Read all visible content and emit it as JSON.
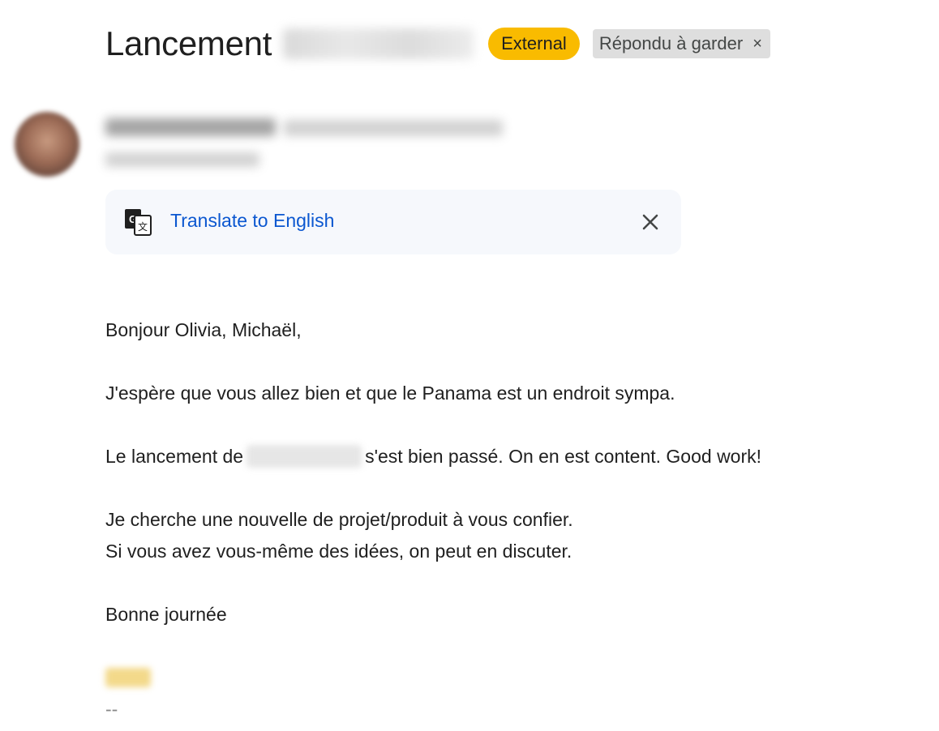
{
  "subject": {
    "title": "Lancement",
    "badges": {
      "external": "External",
      "label": "Répondu à garder",
      "label_remove_glyph": "×"
    }
  },
  "sender": {
    "avatar_icon": "avatar"
  },
  "translate": {
    "icon": "translate-icon",
    "link_text": "Translate to English",
    "close_icon": "close-icon",
    "link_color": "#0b57d0"
  },
  "message": {
    "greeting": "Bonjour Olivia, Michaël,",
    "line1": "J'espère que vous allez bien et que le Panama est un endroit sympa.",
    "line2_prefix": "Le lancement de",
    "line2_suffix": "s'est bien passé. On en est content. Good work!",
    "line3": "Je cherche une nouvelle de projet/produit à vous confier.",
    "line4": "Si vous avez vous-même des idées, on peut en discuter.",
    "closing": "Bonne journée",
    "signature_separator": "--"
  },
  "colors": {
    "external_badge": "#f9bb00",
    "label_badge": "#dedede",
    "translate_bar_bg": "#f6f8fc"
  }
}
